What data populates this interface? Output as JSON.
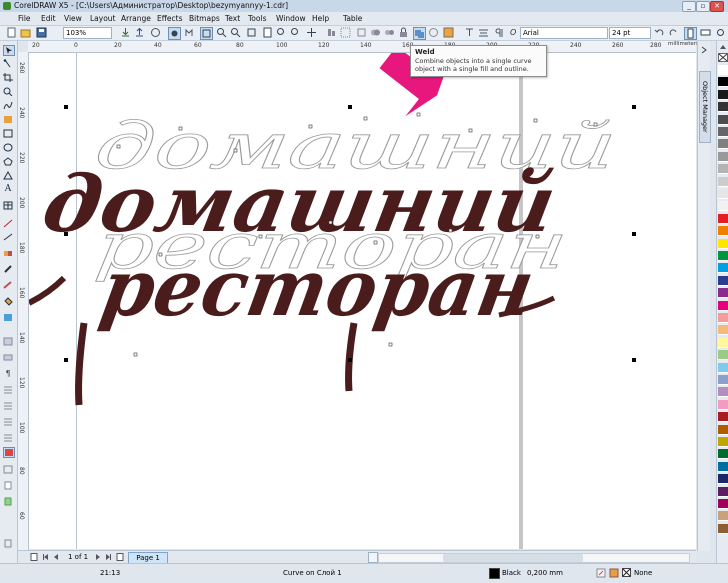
{
  "app": {
    "title": "CorelDRAW X5 - [C:\\Users\\Администратор\\Desktop\\bezymyannyy-1.cdr]",
    "window_controls": [
      "_",
      "▫",
      "✕"
    ]
  },
  "menu": [
    "File",
    "Edit",
    "View",
    "Layout",
    "Arrange",
    "Effects",
    "Bitmaps",
    "Text",
    "Tools",
    "Window",
    "Help",
    "Table"
  ],
  "toolbar": {
    "zoom_value": "103%",
    "font_name": "Arial",
    "font_size": "24 pt"
  },
  "ruler": {
    "units": "millimeters",
    "h_ticks": [
      "20",
      "0",
      "20",
      "40",
      "60",
      "80",
      "100",
      "120",
      "140",
      "160",
      "180",
      "200",
      "220",
      "240",
      "260",
      "280"
    ],
    "v_ticks": [
      "260",
      "240",
      "220",
      "200",
      "180",
      "160",
      "140",
      "120",
      "100",
      "80",
      "60"
    ]
  },
  "tooltip": {
    "title": "Weld",
    "description": "Combine objects into a single curve object with a single fill and outline."
  },
  "artwork": {
    "line1": "домашний",
    "line2": "ресторан",
    "fill_color": "#4a1c1c",
    "accent_color": "#e8177d"
  },
  "docker": {
    "label": "Object Manager"
  },
  "palette_colors": [
    "#ffffff",
    "#000000",
    "#1a1a1a",
    "#333333",
    "#4d4d4d",
    "#666666",
    "#808080",
    "#999999",
    "#b3b3b3",
    "#cccccc",
    "#e6e6e6",
    "#f2f2f2",
    "#e31e24",
    "#ee7f00",
    "#ffe600",
    "#009640",
    "#00a0e3",
    "#2a3c8f",
    "#8a2b8e",
    "#e5007e",
    "#f39c9c",
    "#f5b97a",
    "#fff799",
    "#9ccb86",
    "#7ecbed",
    "#8da0cc",
    "#b38fbf",
    "#f29cc4",
    "#a61e22",
    "#b25c00",
    "#bfa600",
    "#006b2e",
    "#006e9e",
    "#1b2766",
    "#5e1d61",
    "#a3005a",
    "#c8a27a",
    "#8b5e34"
  ],
  "pagebar": {
    "page_counter": "1 of 1",
    "page_tab": "Page 1"
  },
  "status": {
    "coords": "21:13",
    "object_info": "Curve on Слой 1",
    "fill_label": "Black",
    "outline_label": "0,200 mm",
    "outline_none": "None"
  }
}
